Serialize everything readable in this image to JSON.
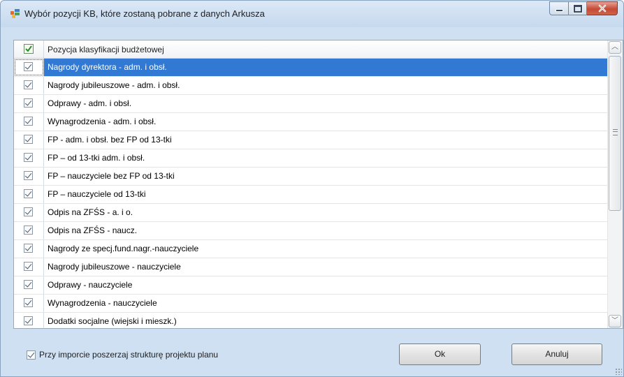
{
  "window": {
    "title": "Wybór pozycji KB, które zostaną pobrane z danych Arkusza"
  },
  "grid": {
    "column_header": "Pozycja klasyfikacji budżetowej",
    "rows": [
      {
        "label": "Nagrody dyrektora - adm. i obsł.",
        "checked": true,
        "selected": true
      },
      {
        "label": "Nagrody jubileuszowe - adm. i obsł.",
        "checked": true
      },
      {
        "label": "Odprawy - adm. i obsł.",
        "checked": true
      },
      {
        "label": "Wynagrodzenia - adm. i obsł.",
        "checked": true
      },
      {
        "label": "FP - adm. i obsł. bez FP od 13-tki",
        "checked": true
      },
      {
        "label": "FP – od 13-tki adm. i obsł.",
        "checked": true
      },
      {
        "label": "FP – nauczyciele bez FP od 13-tki",
        "checked": true
      },
      {
        "label": "FP – nauczyciele od 13-tki",
        "checked": true
      },
      {
        "label": "Odpis na ZFŚS - a. i o.",
        "checked": true
      },
      {
        "label": "Odpis na ZFŚS - naucz.",
        "checked": true
      },
      {
        "label": "Nagrody ze specj.fund.nagr.-nauczyciele",
        "checked": true
      },
      {
        "label": "Nagrody jubileuszowe - nauczyciele",
        "checked": true
      },
      {
        "label": "Odprawy - nauczyciele",
        "checked": true
      },
      {
        "label": "Wynagrodzenia - nauczyciele",
        "checked": true
      },
      {
        "label": "Dodatki socjalne (wiejski i mieszk.)",
        "checked": true
      }
    ]
  },
  "footer": {
    "expand_structure_label": "Przy imporcie poszerzaj strukturę projektu planu",
    "expand_structure_checked": true,
    "ok_label": "Ok",
    "cancel_label": "Anuluj"
  },
  "colors": {
    "selection": "#3279d3",
    "titlebar": "#c6d9ee"
  }
}
